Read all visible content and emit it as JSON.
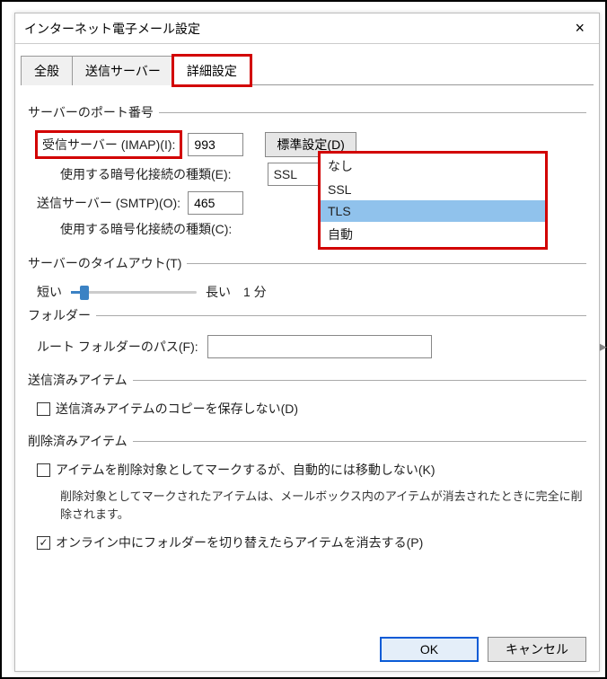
{
  "dialog": {
    "title": "インターネット電子メール設定"
  },
  "tabs": {
    "general": "全般",
    "outgoing": "送信サーバー",
    "advanced": "詳細設定"
  },
  "groups": {
    "ports": "サーバーのポート番号",
    "timeout": "サーバーのタイムアウト(T)",
    "folder": "フォルダー",
    "sent": "送信済みアイテム",
    "deleted": "削除済みアイテム"
  },
  "labels": {
    "imap": "受信サーバー (IMAP)(I):",
    "defaultBtn": "標準設定(D)",
    "encE": "使用する暗号化接続の種類(E):",
    "smtp": "送信サーバー (SMTP)(O):",
    "encC": "使用する暗号化接続の種類(C):",
    "short": "短い",
    "long": "長い",
    "duration": "1 分",
    "rootFolder": "ルート フォルダーのパス(F):"
  },
  "values": {
    "imapPort": "993",
    "smtpPort": "465",
    "encSelected": "SSL",
    "rootFolder": ""
  },
  "encOptions": [
    "なし",
    "SSL",
    "TLS",
    "自動"
  ],
  "encSelectedIdx": 2,
  "checkboxes": {
    "dontSaveSent": "送信済みアイテムのコピーを保存しない(D)",
    "markDelete": "アイテムを削除対象としてマークするが、自動的には移動しない(K)",
    "markDeleteNote": "削除対象としてマークされたアイテムは、メールボックス内のアイテムが消去されたときに完全に削除されます。",
    "purgeOnSwitch": "オンライン中にフォルダーを切り替えたらアイテムを消去する(P)"
  },
  "buttons": {
    "ok": "OK",
    "cancel": "キャンセル"
  }
}
